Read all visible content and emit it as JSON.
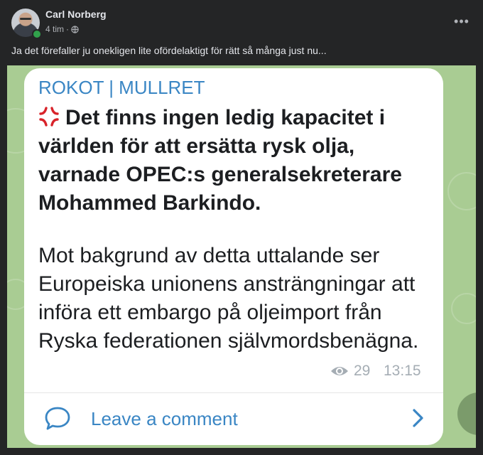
{
  "post": {
    "author": "Carl Norberg",
    "time": "4 tim",
    "separator": "·",
    "privacy_icon": "globe-icon",
    "more_label": "•••",
    "text": "Ja det förefaller ju onekligen lite ofördelaktigt för rätt så många just nu..."
  },
  "telegram": {
    "channel": "ROKOT | MULLRET",
    "headline_icon": "anger-icon",
    "headline": "Det finns ingen ledig kapacitet i världen för att ersätta rysk olja, varnade OPEC:s generalsekreterare Mohammed Barkindo.",
    "body": "Mot bakgrund av detta uttalande ser Europeiska unionens ansträngningar att införa ett embargo på oljeimport från Ryska federationen självmordsbenägna.",
    "views": "29",
    "time": "13:15",
    "comment_label": "Leave a comment"
  },
  "colors": {
    "background": "#242526",
    "image_background": "#a9cc93",
    "accent": "#3a86c4",
    "online": "#31a24c",
    "anger": "#d8232a"
  }
}
